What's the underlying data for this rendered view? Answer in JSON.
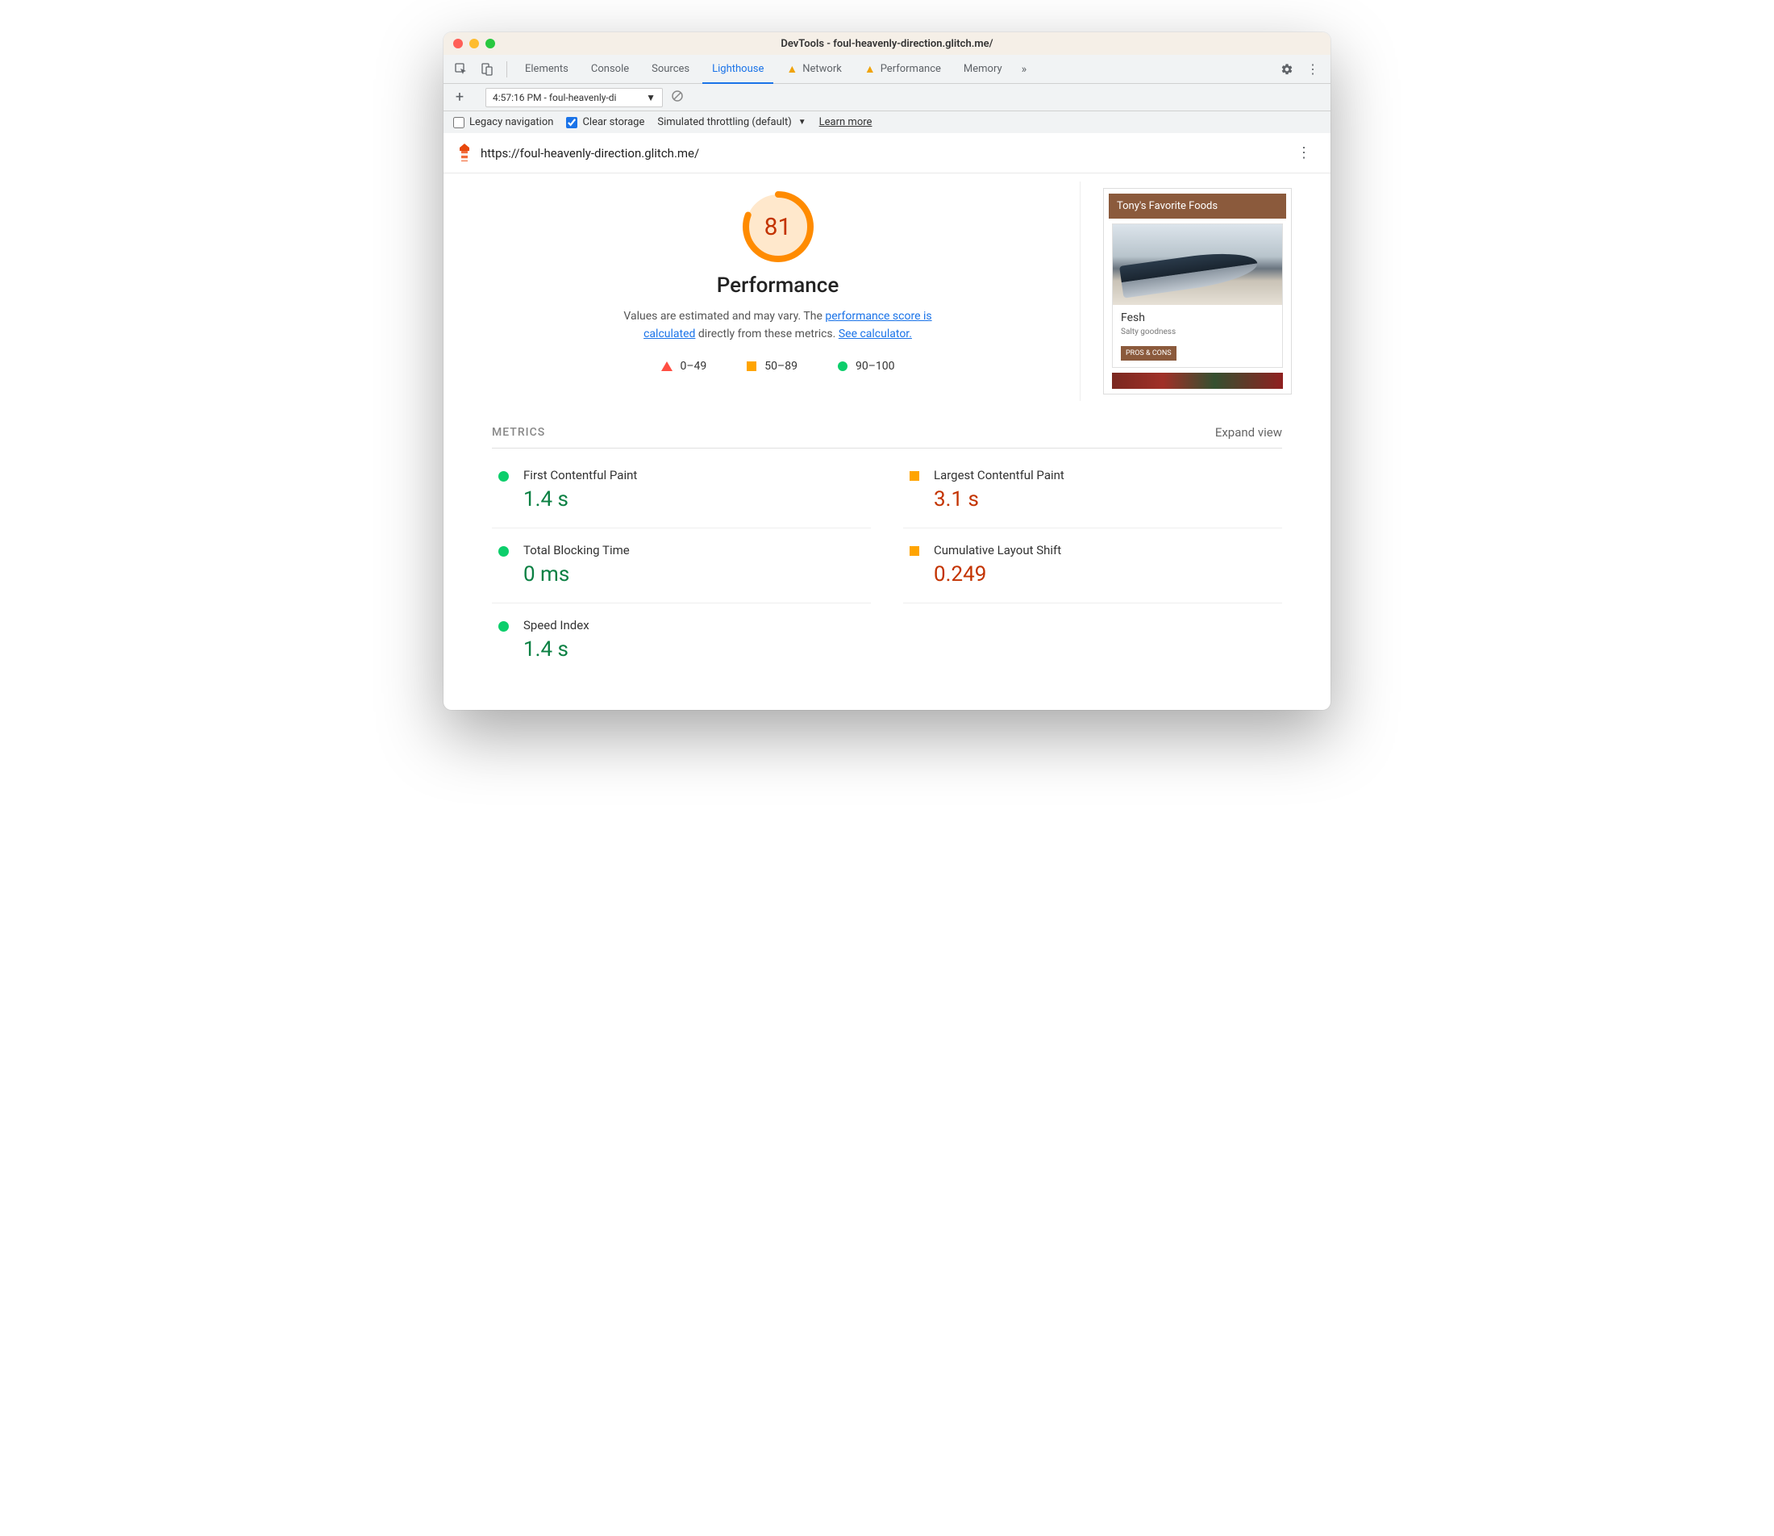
{
  "window": {
    "title": "DevTools - foul-heavenly-direction.glitch.me/"
  },
  "tabs": {
    "items": [
      "Elements",
      "Console",
      "Sources",
      "Lighthouse",
      "Network",
      "Performance",
      "Memory"
    ],
    "active": "Lighthouse",
    "warn": [
      "Network",
      "Performance"
    ]
  },
  "subbar": {
    "report_label": "4:57:16 PM - foul-heavenly-di"
  },
  "options": {
    "legacy": "Legacy navigation",
    "clear": "Clear storage",
    "throttling": "Simulated throttling (default)",
    "learn": "Learn more"
  },
  "url": "https://foul-heavenly-direction.glitch.me/",
  "gauge": {
    "score": "81",
    "category": "Performance"
  },
  "desc": {
    "t1": "Values are estimated and may vary. The ",
    "l1": "performance score is calculated",
    "t2": " directly from these metrics. ",
    "l2": "See calculator."
  },
  "legend": {
    "bad": "0–49",
    "avg": "50–89",
    "good": "90–100"
  },
  "preview": {
    "header": "Tony's Favorite Foods",
    "card_title": "Fesh",
    "card_sub": "Salty goodness",
    "card_btn": "PROS & CONS"
  },
  "metrics": {
    "heading": "METRICS",
    "expand": "Expand view",
    "items": [
      {
        "name": "First Contentful Paint",
        "value": "1.4 s",
        "status": "good"
      },
      {
        "name": "Largest Contentful Paint",
        "value": "3.1 s",
        "status": "avg"
      },
      {
        "name": "Total Blocking Time",
        "value": "0 ms",
        "status": "good"
      },
      {
        "name": "Cumulative Layout Shift",
        "value": "0.249",
        "status": "avg"
      },
      {
        "name": "Speed Index",
        "value": "1.4 s",
        "status": "good"
      }
    ]
  }
}
